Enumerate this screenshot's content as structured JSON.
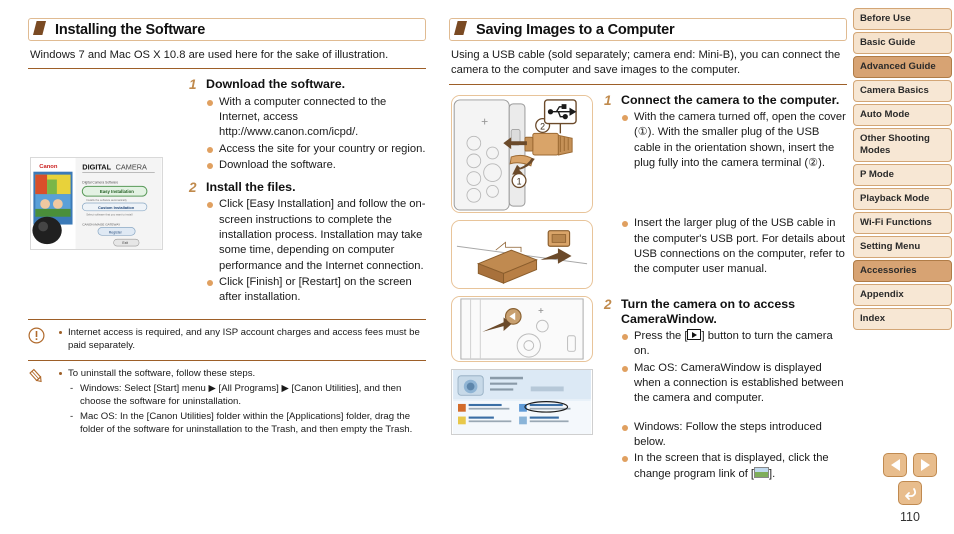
{
  "left": {
    "header": "Installing the Software",
    "intro": "Windows 7 and Mac OS X 10.8 are used here for the sake of illustration.",
    "installer_image": "canon-installer-screenshot",
    "steps": [
      {
        "num": "1",
        "title": "Download the software.",
        "bullets": [
          "With a computer connected to the Internet, access http://www.canon.com/icpd/.",
          "Access the site for your country or region.",
          "Download the software."
        ]
      },
      {
        "num": "2",
        "title": "Install the files.",
        "bullets": [
          "Click [Easy Installation] and follow the on-screen instructions to complete the installation process. Installation may take some time, depending on computer performance and the Internet connection.",
          "Click [Finish] or [Restart] on the screen after installation."
        ]
      }
    ],
    "notes": [
      {
        "icon": "caution-icon",
        "lines": [
          {
            "type": "dot",
            "text": "Internet access is required, and any ISP account charges and access fees must be paid separately."
          }
        ]
      },
      {
        "icon": "pencil-note-icon",
        "lines": [
          {
            "type": "dot",
            "text": "To uninstall the software, follow these steps."
          },
          {
            "type": "sub",
            "text": "Windows: Select [Start] menu ▶ [All Programs] ▶ [Canon Utilities], and then choose the software for uninstallation."
          },
          {
            "type": "sub",
            "text": "Mac OS: In the [Canon Utilities] folder within the [Applications] folder, drag the folder of the software for uninstallation to the Trash, and then empty the Trash."
          }
        ]
      }
    ]
  },
  "middle": {
    "header": "Saving Images to a Computer",
    "intro": "Using a USB cable (sold separately; camera end: Mini-B), you can connect the camera to the computer and save images to the computer.",
    "figures": [
      "camera-usb-cover-open-figure",
      "usb-plug-into-computer-port-figure",
      "camera-playback-button-figure",
      "windows-autoplay-dialog-screenshot"
    ],
    "steps": [
      {
        "num": "1",
        "title": "Connect the camera to the computer.",
        "bullets": [
          "With the camera turned off, open the cover (①). With the smaller plug of the USB cable in the orientation shown, insert the plug fully into the camera terminal (②).",
          "Insert the larger plug of the USB cable in the computer's USB port. For details about USB connections on the computer, refer to the computer user manual."
        ]
      },
      {
        "num": "2",
        "title": "Turn the camera on to access CameraWindow.",
        "bullets": [
          "Press the [▶] button to turn the camera on.",
          "Mac OS: CameraWindow is displayed when a connection is established between the camera and computer.",
          "Windows: Follow the steps introduced below.",
          "In the screen that is displayed, click the change program link of [ ]."
        ]
      }
    ]
  },
  "sidebar": {
    "items": [
      {
        "label": "Before Use",
        "state": "normal",
        "lines": 1
      },
      {
        "label": "Basic Guide",
        "state": "normal",
        "lines": 1
      },
      {
        "label": "Advanced Guide",
        "state": "active",
        "lines": 1
      },
      {
        "label": "Camera Basics",
        "state": "sub",
        "lines": 1
      },
      {
        "label": "Auto Mode",
        "state": "sub",
        "lines": 1
      },
      {
        "label": "Other Shooting Modes",
        "state": "sub",
        "lines": 2
      },
      {
        "label": "P Mode",
        "state": "sub",
        "lines": 1
      },
      {
        "label": "Playback Mode",
        "state": "sub",
        "lines": 1
      },
      {
        "label": "Wi-Fi Functions",
        "state": "sub",
        "lines": 1
      },
      {
        "label": "Setting Menu",
        "state": "sub",
        "lines": 1
      },
      {
        "label": "Accessories",
        "state": "active",
        "lines": 1
      },
      {
        "label": "Appendix",
        "state": "sub",
        "lines": 1
      },
      {
        "label": "Index",
        "state": "sub",
        "lines": 1
      }
    ]
  },
  "pager": {
    "prev": "previous-page",
    "next": "next-page",
    "back": "back-to-previous-view",
    "page_number": "110"
  },
  "colors": {
    "accent_brown": "#9d5f28",
    "flag_brown": "#7a4a23",
    "bullet_orange": "#e0a060",
    "nav_bg": "#f6e3cd",
    "nav_active": "#d7a373",
    "nav_border": "#d3a676",
    "step_num": "#c08a4c"
  }
}
